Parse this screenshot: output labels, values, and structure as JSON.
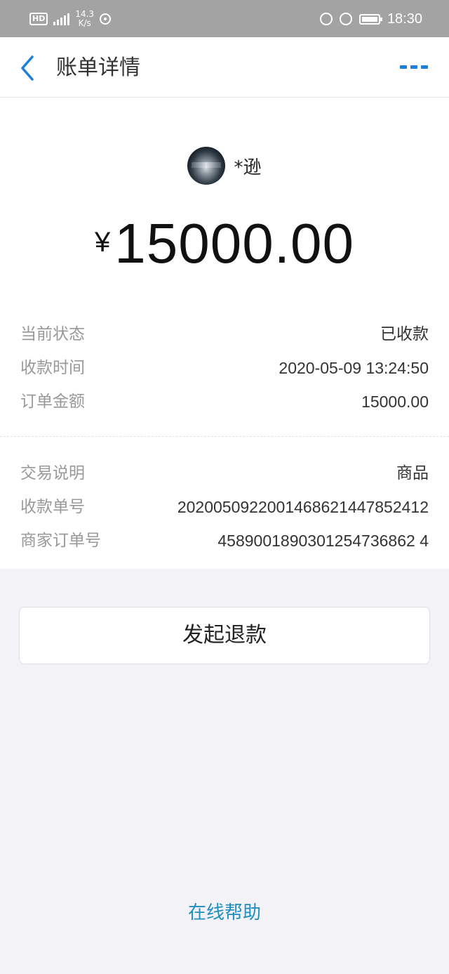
{
  "status_bar": {
    "hd": "HD",
    "network": "4G",
    "speed_value": "14.3",
    "speed_unit": "K/s",
    "time": "18:30"
  },
  "nav": {
    "title": "账单详情",
    "accent_color": "#1e7fd6"
  },
  "payee": {
    "name": "*逊"
  },
  "amount": {
    "symbol": "¥",
    "value": "15000.00"
  },
  "details": [
    {
      "label": "当前状态",
      "value": "已收款"
    },
    {
      "label": "收款时间",
      "value": "2020-05-09 13:24:50"
    },
    {
      "label": "订单金额",
      "value": "15000.00"
    }
  ],
  "details2": [
    {
      "label": "交易说明",
      "value": "商品"
    },
    {
      "label": "收款单号",
      "value": "2020050922001468621447852412"
    },
    {
      "label": "商家订单号",
      "value": "4589001890301254736862 4"
    }
  ],
  "actions": {
    "refund_label": "发起退款"
  },
  "footer": {
    "help_label": "在线帮助",
    "help_color": "#1f8fbf"
  }
}
